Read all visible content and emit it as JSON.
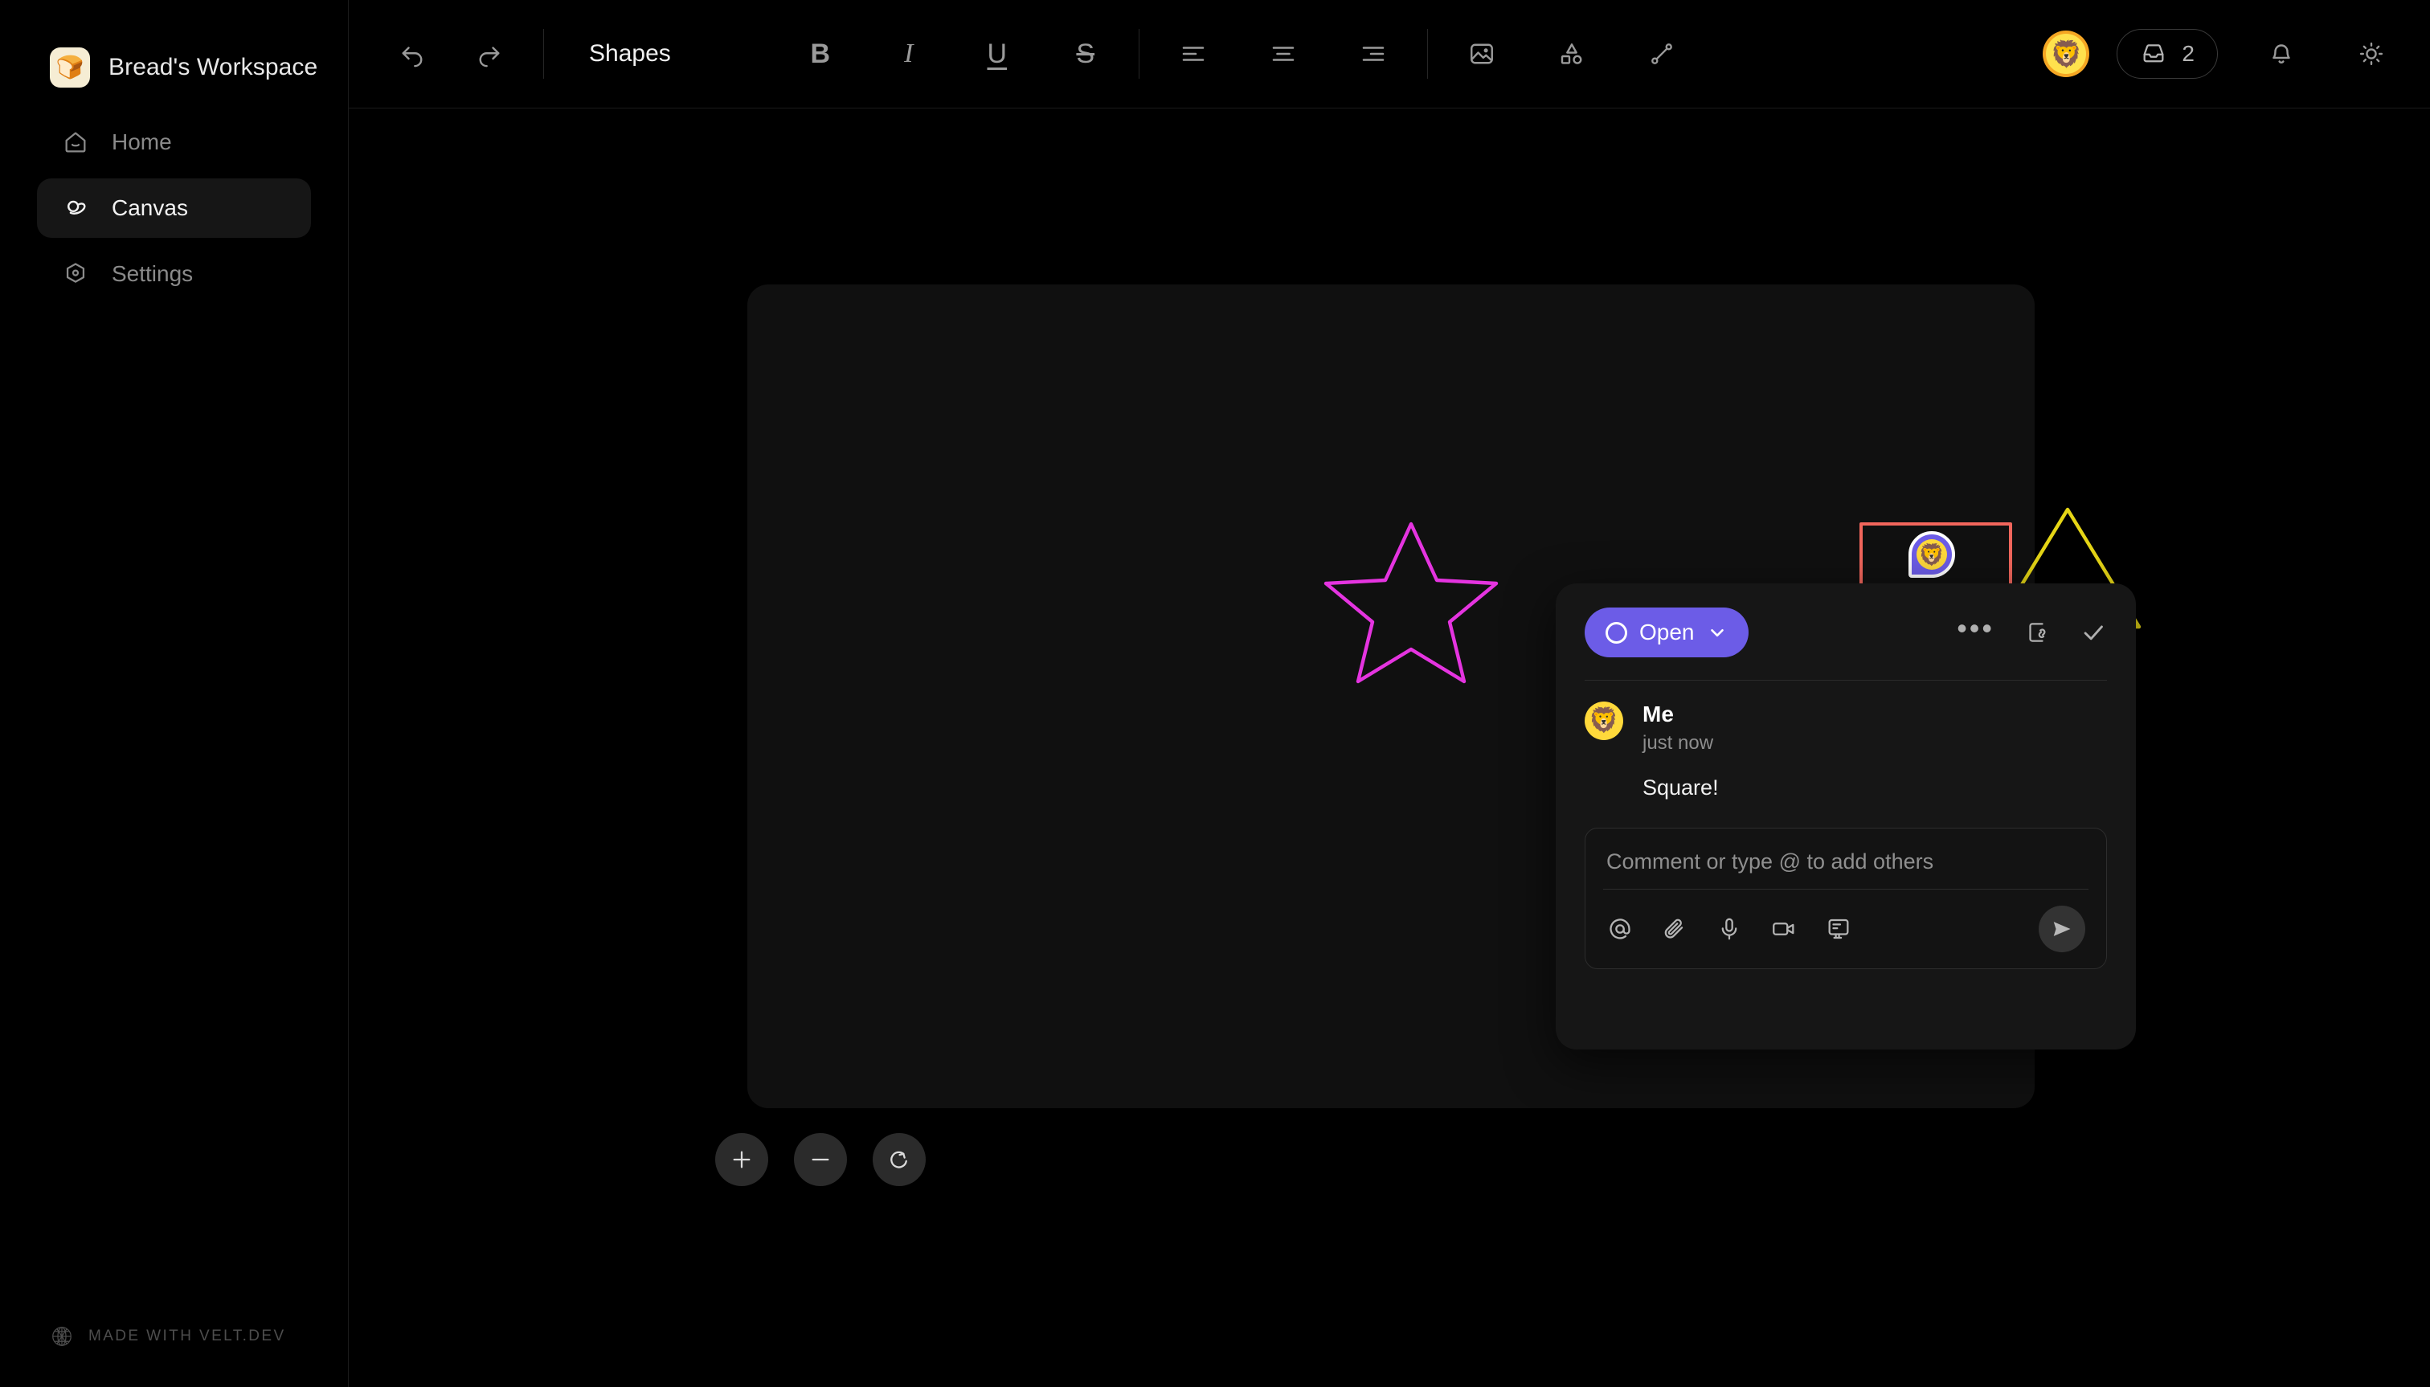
{
  "workspace": {
    "name": "Bread's Workspace",
    "logo_icon": "bread-icon",
    "logo_glyph": "🍞",
    "logo_bg": "#F6EDD4"
  },
  "sidebar": {
    "items": [
      {
        "label": "Home",
        "icon": "home-icon",
        "active": false
      },
      {
        "label": "Canvas",
        "icon": "canvas-swirl-icon",
        "active": true
      },
      {
        "label": "Settings",
        "icon": "hexagon-gear-icon",
        "active": false
      }
    ],
    "footer": {
      "label": "MADE WITH VELT.DEV",
      "icon": "velt-sphere-icon"
    }
  },
  "topbar": {
    "undo_icon": "undo-icon",
    "redo_icon": "redo-icon",
    "doc_title": "Shapes",
    "format": [
      {
        "label": "B",
        "name": "bold-button"
      },
      {
        "label": "I",
        "name": "italic-button"
      },
      {
        "label": "U",
        "name": "underline-button"
      },
      {
        "label": "S",
        "name": "strikethrough-button"
      }
    ],
    "align": [
      "align-left-icon",
      "align-center-icon",
      "align-right-icon"
    ],
    "insert": [
      "image-icon",
      "shapes-icon",
      "line-icon"
    ],
    "avatar_glyph": "🦁",
    "avatar_ring_color": "#F5A623",
    "inbox": {
      "icon": "inbox-icon",
      "count": "2"
    },
    "notifications_icon": "bell-icon",
    "theme_icon": "sun-icon"
  },
  "canvas": {
    "shapes": [
      {
        "name": "star-shape",
        "type": "star",
        "stroke": "#E534E0"
      },
      {
        "name": "square-shape",
        "type": "square",
        "stroke": "#F2665C"
      },
      {
        "name": "triangle-shape",
        "type": "triangle",
        "stroke": "#E6D616"
      }
    ],
    "pin": {
      "name": "comment-pin",
      "avatar_glyph": "🦁",
      "color": "#6C5CE7"
    },
    "zoom_controls": [
      {
        "name": "zoom-in-button",
        "icon": "plus-icon"
      },
      {
        "name": "zoom-out-button",
        "icon": "minus-icon"
      },
      {
        "name": "reset-view-button",
        "icon": "refresh-icon"
      }
    ]
  },
  "comment_panel": {
    "status": {
      "label": "Open",
      "color": "#6C5CE7",
      "chevron": "chevron-down-icon"
    },
    "actions": [
      {
        "name": "more-options-button",
        "icon": "ellipsis-icon"
      },
      {
        "name": "copy-link-button",
        "icon": "copy-link-icon"
      },
      {
        "name": "resolve-button",
        "icon": "check-icon"
      }
    ],
    "comment": {
      "author": "Me",
      "timestamp": "just now",
      "text": "Square!",
      "avatar_glyph": "🦁"
    },
    "composer": {
      "placeholder": "Comment or type @ to add others",
      "value": "",
      "tools": [
        {
          "name": "mention-button",
          "icon": "at-icon"
        },
        {
          "name": "attach-button",
          "icon": "paperclip-icon"
        },
        {
          "name": "voice-button",
          "icon": "microphone-icon"
        },
        {
          "name": "video-button",
          "icon": "video-camera-icon"
        },
        {
          "name": "screen-record-button",
          "icon": "screen-record-icon"
        }
      ],
      "send": {
        "name": "send-button",
        "icon": "send-icon"
      }
    }
  }
}
